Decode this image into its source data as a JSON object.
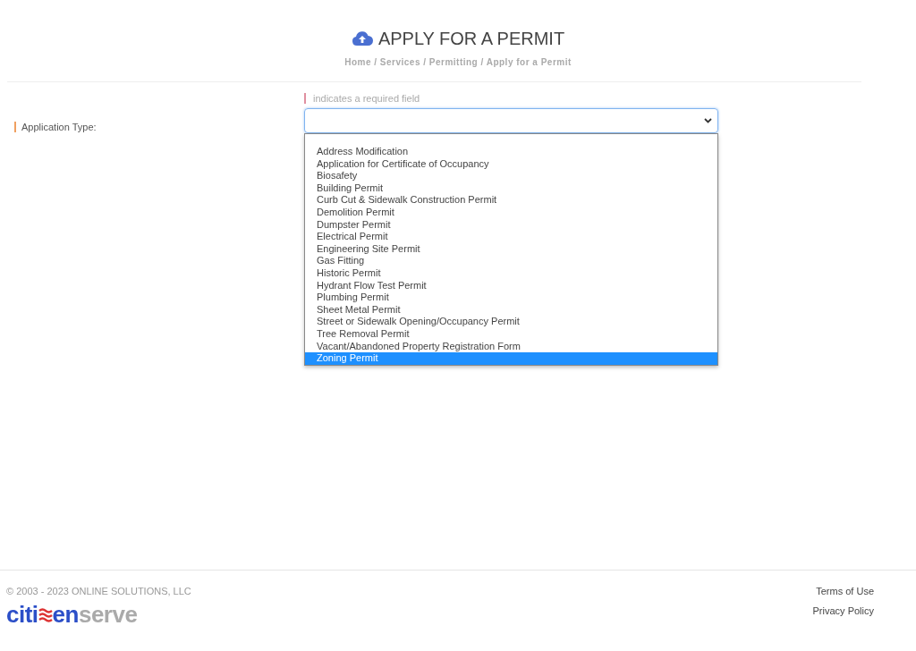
{
  "header": {
    "title": "APPLY FOR A PERMIT",
    "breadcrumb": "Home / Services / Permitting / Apply for a Permit"
  },
  "form": {
    "required_note": "indicates a required field",
    "field": {
      "label": "Application Type:",
      "required": true,
      "expanded": true
    },
    "options": [
      {
        "label": "Address Modification",
        "selected": false
      },
      {
        "label": "Application for Certificate of Occupancy",
        "selected": false
      },
      {
        "label": "Biosafety",
        "selected": false
      },
      {
        "label": "Building Permit",
        "selected": false
      },
      {
        "label": "Curb Cut & Sidewalk Construction Permit",
        "selected": false
      },
      {
        "label": "Demolition Permit",
        "selected": false
      },
      {
        "label": "Dumpster Permit",
        "selected": false
      },
      {
        "label": "Electrical Permit",
        "selected": false
      },
      {
        "label": "Engineering Site Permit",
        "selected": false
      },
      {
        "label": "Gas Fitting",
        "selected": false
      },
      {
        "label": "Historic Permit",
        "selected": false
      },
      {
        "label": "Hydrant Flow Test Permit",
        "selected": false
      },
      {
        "label": "Plumbing Permit",
        "selected": false
      },
      {
        "label": "Sheet Metal Permit",
        "selected": false
      },
      {
        "label": "Street or Sidewalk Opening/Occupancy Permit",
        "selected": false
      },
      {
        "label": "Tree Removal Permit",
        "selected": false
      },
      {
        "label": "Vacant/Abandoned Property Registration Form",
        "selected": false
      },
      {
        "label": "Zoning Permit",
        "selected": true
      }
    ]
  },
  "footer": {
    "copyright": "© 2003 - 2023 ONLINE SOLUTIONS, LLC",
    "logo": {
      "lead": "citi",
      "middle": "en",
      "tail": "serve"
    },
    "links": [
      "Terms of Use",
      "Privacy Policy"
    ]
  }
}
